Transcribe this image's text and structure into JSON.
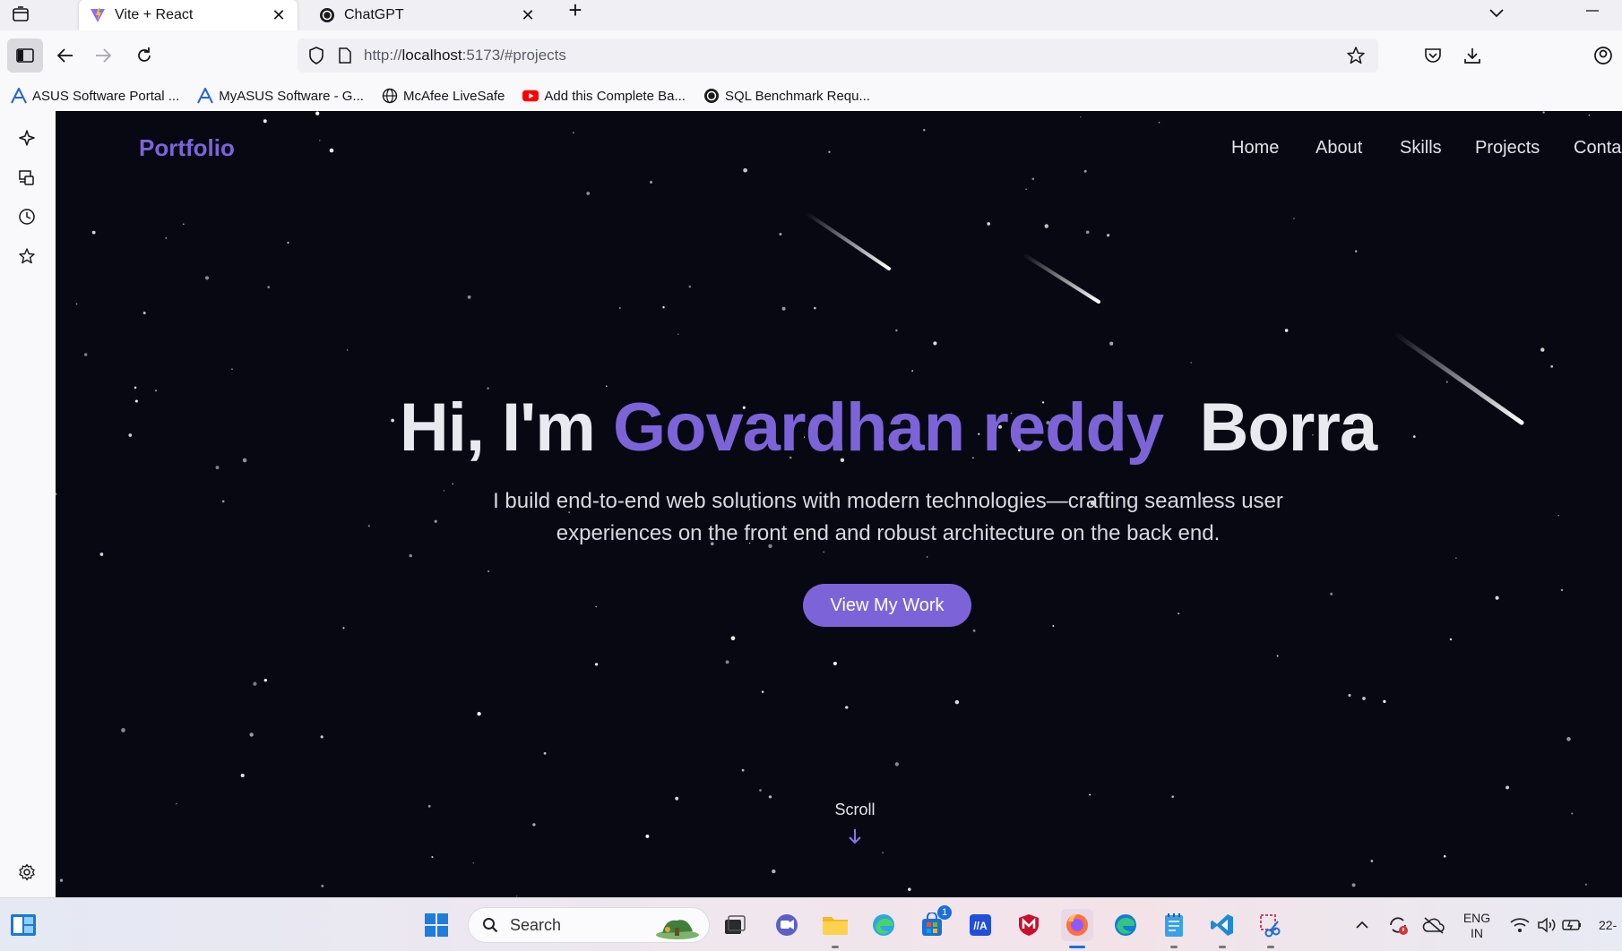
{
  "browser": {
    "tabs": [
      {
        "title": "Vite + React",
        "active": true,
        "icon": "vite-icon"
      },
      {
        "title": "ChatGPT",
        "active": false,
        "icon": "chatgpt-icon"
      }
    ],
    "url": {
      "prefix": "http://",
      "host": "localhost",
      "rest": ":5173/#projects"
    },
    "bookmarks": [
      {
        "label": "ASUS Software Portal ...",
        "icon": "asus-icon"
      },
      {
        "label": "MyASUS Software - G...",
        "icon": "myasus-icon"
      },
      {
        "label": "McAfee LiveSafe",
        "icon": "globe-icon"
      },
      {
        "label": "Add this Complete Ba...",
        "icon": "youtube-icon"
      },
      {
        "label": "SQL Benchmark Requ...",
        "icon": "chatgpt-icon"
      }
    ]
  },
  "site": {
    "brand": "Portfolio",
    "nav": [
      "Home",
      "About",
      "Skills",
      "Projects",
      "Conta"
    ],
    "hero": {
      "greeting": "Hi, I'm",
      "name_accent": "Govardhan reddy",
      "name_rest": "Borra",
      "subtitle_line1": "I build end-to-end web solutions with modern technologies—crafting seamless user",
      "subtitle_line2": "experiences on the front end and robust architecture on the back end."
    },
    "cta": "View My Work",
    "scroll": "Scroll"
  },
  "taskbar": {
    "search_placeholder": "Search",
    "store_badge": "1",
    "lang_line1": "ENG",
    "lang_line2": "IN",
    "clock_partial": "22-"
  },
  "colors": {
    "accent": "#7c64d8",
    "page_bg": "#070812"
  }
}
